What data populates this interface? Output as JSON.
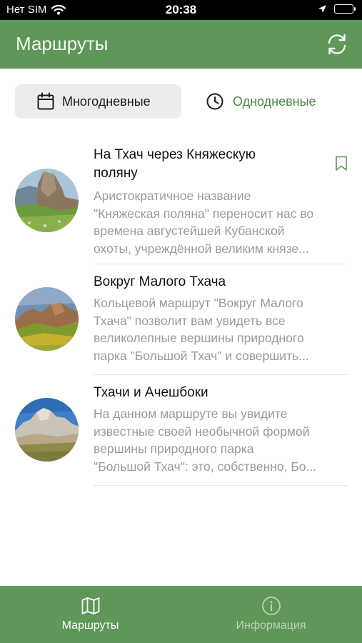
{
  "status_bar": {
    "carrier": "Нет SIM",
    "time": "20:38",
    "icons": [
      "wifi-icon",
      "location-arrow-icon",
      "battery-icon"
    ]
  },
  "nav_bar": {
    "title": "Маршруты",
    "refresh_icon": "refresh-icon"
  },
  "segments": {
    "multi_day": {
      "label": "Многодневные",
      "icon": "calendar-icon",
      "selected": true
    },
    "one_day": {
      "label": "Однодневные",
      "icon": "clock-icon",
      "selected": false
    }
  },
  "routes": [
    {
      "title_lines": [
        "На Тхач через Княжескую",
        "поляну"
      ],
      "desc_lines": [
        "Аристократичное название",
        "\"Княжеская поляна\" переносит нас во",
        "времена августейшей Кубанской",
        "охоты, учреждённой великим князе..."
      ],
      "bookmark_icon": "bookmark-icon"
    },
    {
      "title_lines": [
        "Вокруг Малого Тхача"
      ],
      "desc_lines": [
        "Кольцевой маршрут \"Вокруг Малого",
        "Тхача\" позволит вам увидеть все",
        "великолепные вершины природного",
        "парка \"Большой Тхач\" и совершить..."
      ]
    },
    {
      "title_lines": [
        "Тхачи и Ачешбоки"
      ],
      "desc_lines": [
        "На данном маршруте вы увидите",
        "известные своей необычной формой",
        "вершины природного парка",
        "\"Большой Тхач\": это, собственно, Бо..."
      ]
    }
  ],
  "tab_bar": {
    "routes": {
      "label": "Маршруты",
      "icon": "map-icon",
      "active": true
    },
    "info": {
      "label": "Информация",
      "icon": "info-icon",
      "active": false
    }
  },
  "colors": {
    "brand_green": "#5e9758",
    "accent_green_text": "#4a8a45",
    "segment_bg": "#ececec",
    "muted_text": "#9a9a9a"
  }
}
